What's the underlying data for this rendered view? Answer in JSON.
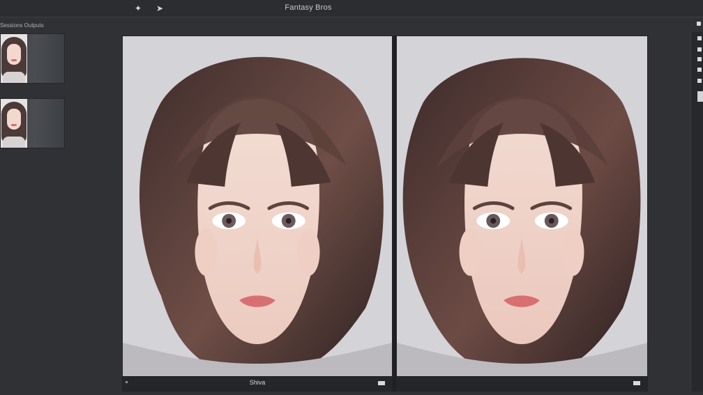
{
  "window": {
    "title": "Fantasy Bros"
  },
  "toolbar": {
    "icons": [
      "pin-icon",
      "pointer-icon"
    ]
  },
  "sidebar": {
    "title": "Sessions Outputs",
    "thumbnails": [
      {
        "name": "portrait-thumbnail-1"
      },
      {
        "name": "portrait-thumbnail-2"
      }
    ]
  },
  "comparison": {
    "left_label": "Shiva",
    "right_label": ""
  },
  "right_panel": {
    "items": [
      "tool-item-1",
      "tool-item-2",
      "tool-item-3",
      "tool-item-4",
      "tool-item-5"
    ]
  },
  "colors": {
    "background": "#2f3134",
    "panel": "#d4d3d8",
    "hair": "#5a3f3a",
    "skin": "#f0d5cc",
    "lips": "#d86f72"
  }
}
